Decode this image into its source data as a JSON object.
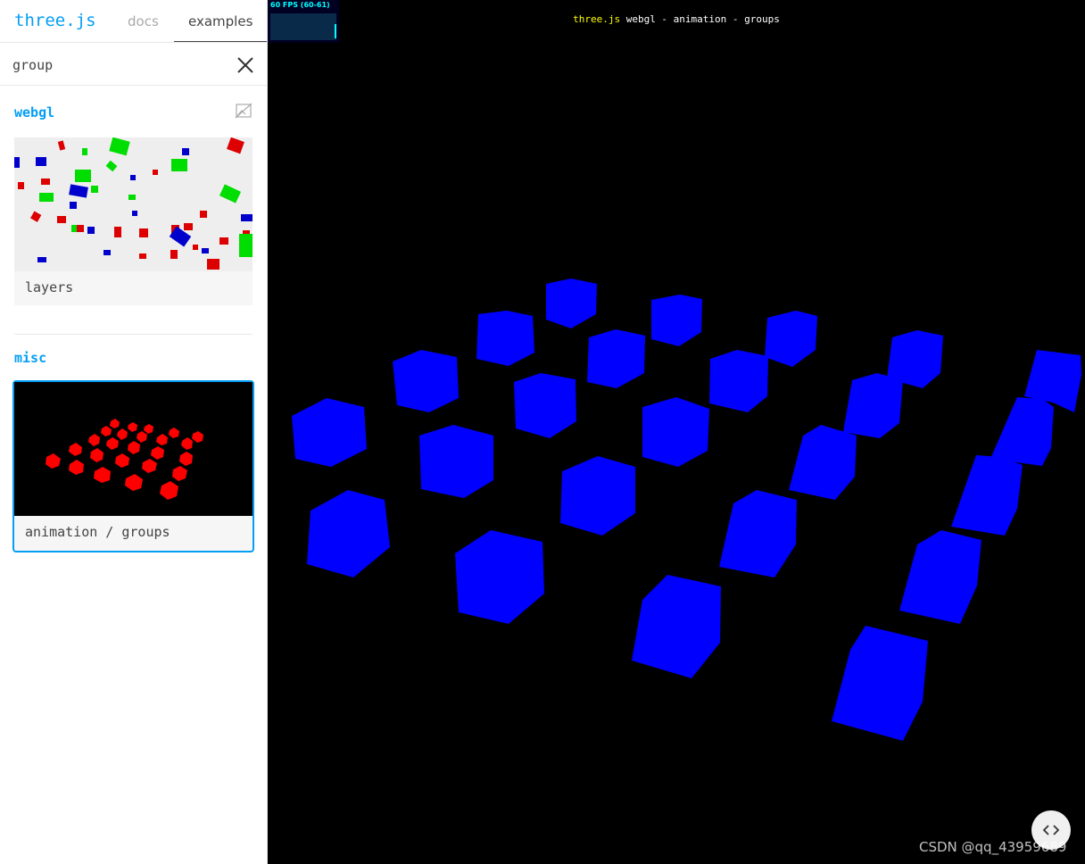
{
  "header": {
    "brand": "three.js",
    "tab_docs": "docs",
    "tab_examples": "examples"
  },
  "filter": {
    "value": "group",
    "placeholder": ""
  },
  "categories": {
    "webgl": "webgl",
    "misc": "misc"
  },
  "cards": {
    "layers": "layers",
    "groups": "animation / groups"
  },
  "stats": {
    "fps_text": "60 FPS (60-61)"
  },
  "info": {
    "link": "three.js",
    "rest": " webgl - animation - groups"
  },
  "watermark": "CSDN @qq_43959689",
  "colors": {
    "accent": "#049ef4",
    "cube": "#0000ff",
    "thumb_red": "#ff0000",
    "thumb_green": "#00dd00",
    "thumb_blue": "#0000cc"
  },
  "icons": {
    "clear": "close-icon",
    "screenshot_toggle": "image-off-icon",
    "code": "code-icon"
  }
}
